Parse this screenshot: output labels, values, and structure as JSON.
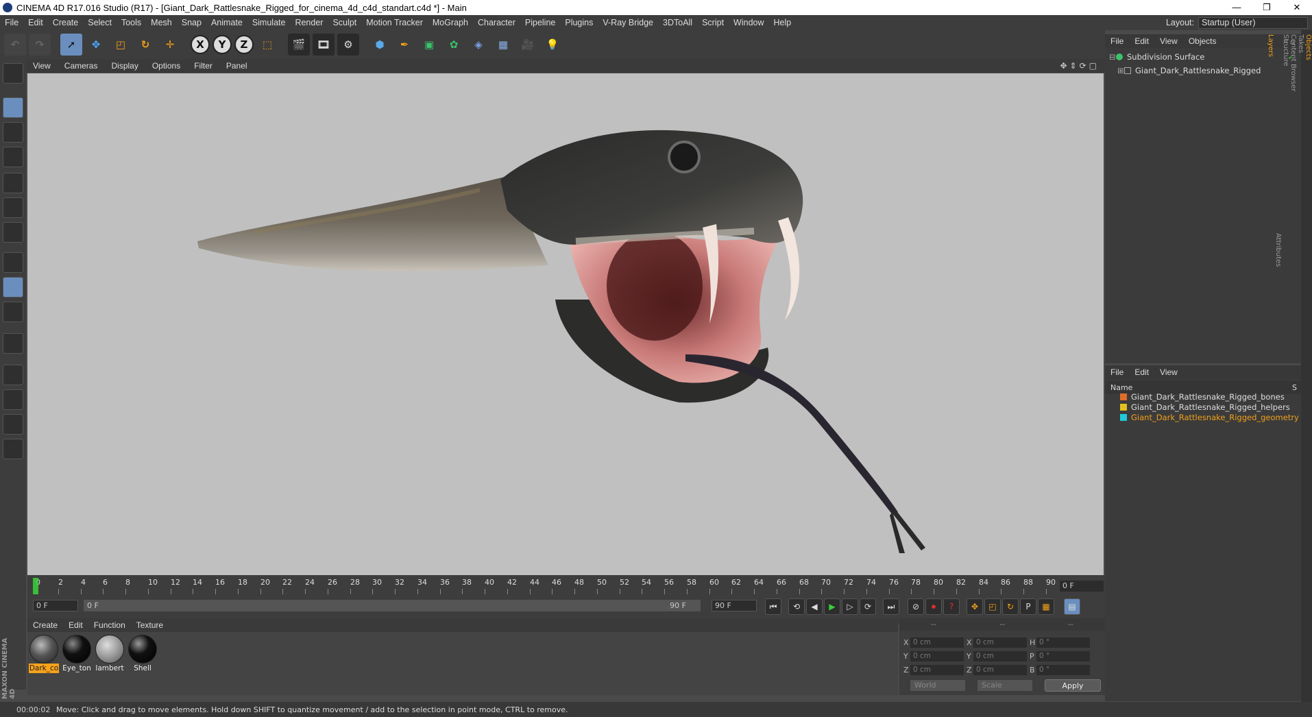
{
  "window": {
    "title": "CINEMA 4D R17.016 Studio (R17) - [Giant_Dark_Rattlesnake_Rigged_for_cinema_4d_c4d_standart.c4d *] - Main",
    "controls": [
      "—",
      "❐",
      "✕"
    ]
  },
  "menu": {
    "items": [
      "File",
      "Edit",
      "Create",
      "Select",
      "Tools",
      "Mesh",
      "Snap",
      "Animate",
      "Simulate",
      "Render",
      "Sculpt",
      "Motion Tracker",
      "MoGraph",
      "Character",
      "Pipeline",
      "Plugins",
      "V-Ray Bridge",
      "3DToAll",
      "Script",
      "Window",
      "Help"
    ],
    "layout_label": "Layout:",
    "layout_value": "Startup (User)"
  },
  "toolbar": {
    "axis_x": "X",
    "axis_y": "Y",
    "axis_z": "Z"
  },
  "viewport": {
    "menu": [
      "View",
      "Cameras",
      "Display",
      "Options",
      "Filter",
      "Panel"
    ]
  },
  "timeline": {
    "ticks": [
      "0",
      "2",
      "4",
      "6",
      "8",
      "10",
      "12",
      "14",
      "16",
      "18",
      "20",
      "22",
      "24",
      "26",
      "28",
      "30",
      "32",
      "34",
      "36",
      "38",
      "40",
      "42",
      "44",
      "46",
      "48",
      "50",
      "52",
      "54",
      "56",
      "58",
      "60",
      "62",
      "64",
      "66",
      "68",
      "70",
      "72",
      "74",
      "76",
      "78",
      "80",
      "82",
      "84",
      "86",
      "88",
      "90"
    ],
    "current_frame": "0 F"
  },
  "playbar": {
    "start": "0 F",
    "range_start": "0 F",
    "range_end": "90 F",
    "end": "90 F"
  },
  "materials": {
    "menu": [
      "Create",
      "Edit",
      "Function",
      "Texture"
    ],
    "items": [
      {
        "name": "Dark_co"
      },
      {
        "name": "Eye_ton"
      },
      {
        "name": "lambert"
      },
      {
        "name": "Shell"
      }
    ]
  },
  "coords": {
    "rows": [
      {
        "a": "X",
        "av": "0 cm",
        "b": "X",
        "bv": "0 cm",
        "c": "H",
        "cv": "0 °"
      },
      {
        "a": "Y",
        "av": "0 cm",
        "b": "Y",
        "bv": "0 cm",
        "c": "P",
        "cv": "0 °"
      },
      {
        "a": "Z",
        "av": "0 cm",
        "b": "Z",
        "bv": "0 cm",
        "c": "B",
        "cv": "0 °"
      }
    ],
    "mode1": "World",
    "mode2": "Scale",
    "apply": "Apply",
    "hdr": [
      "--",
      "--",
      "--"
    ]
  },
  "objects": {
    "menu": [
      "File",
      "Edit",
      "View",
      "Objects"
    ],
    "items": [
      "Subdivision Surface",
      "Giant_Dark_Rattlesnake_Rigged"
    ]
  },
  "layers": {
    "menu": [
      "File",
      "Edit",
      "View"
    ],
    "col_name": "Name",
    "col_s": "S",
    "items": [
      {
        "name": "Giant_Dark_Rattlesnake_Rigged_bones",
        "color": "#e06c2a"
      },
      {
        "name": "Giant_Dark_Rattlesnake_Rigged_helpers",
        "color": "#e0c020"
      },
      {
        "name": "Giant_Dark_Rattlesnake_Rigged_geometry",
        "color": "#20c8d8"
      }
    ]
  },
  "right_tabs": [
    "Objects",
    "Takes",
    "Content Browser",
    "Structure",
    "Attributes",
    "Layers"
  ],
  "status": {
    "time": "00:00:02",
    "message": "Move: Click and drag to move elements. Hold down SHIFT to quantize movement / add to the selection in point mode, CTRL to remove."
  },
  "brand": {
    "line1": "MAXON",
    "line2": "CINEMA 4D"
  }
}
